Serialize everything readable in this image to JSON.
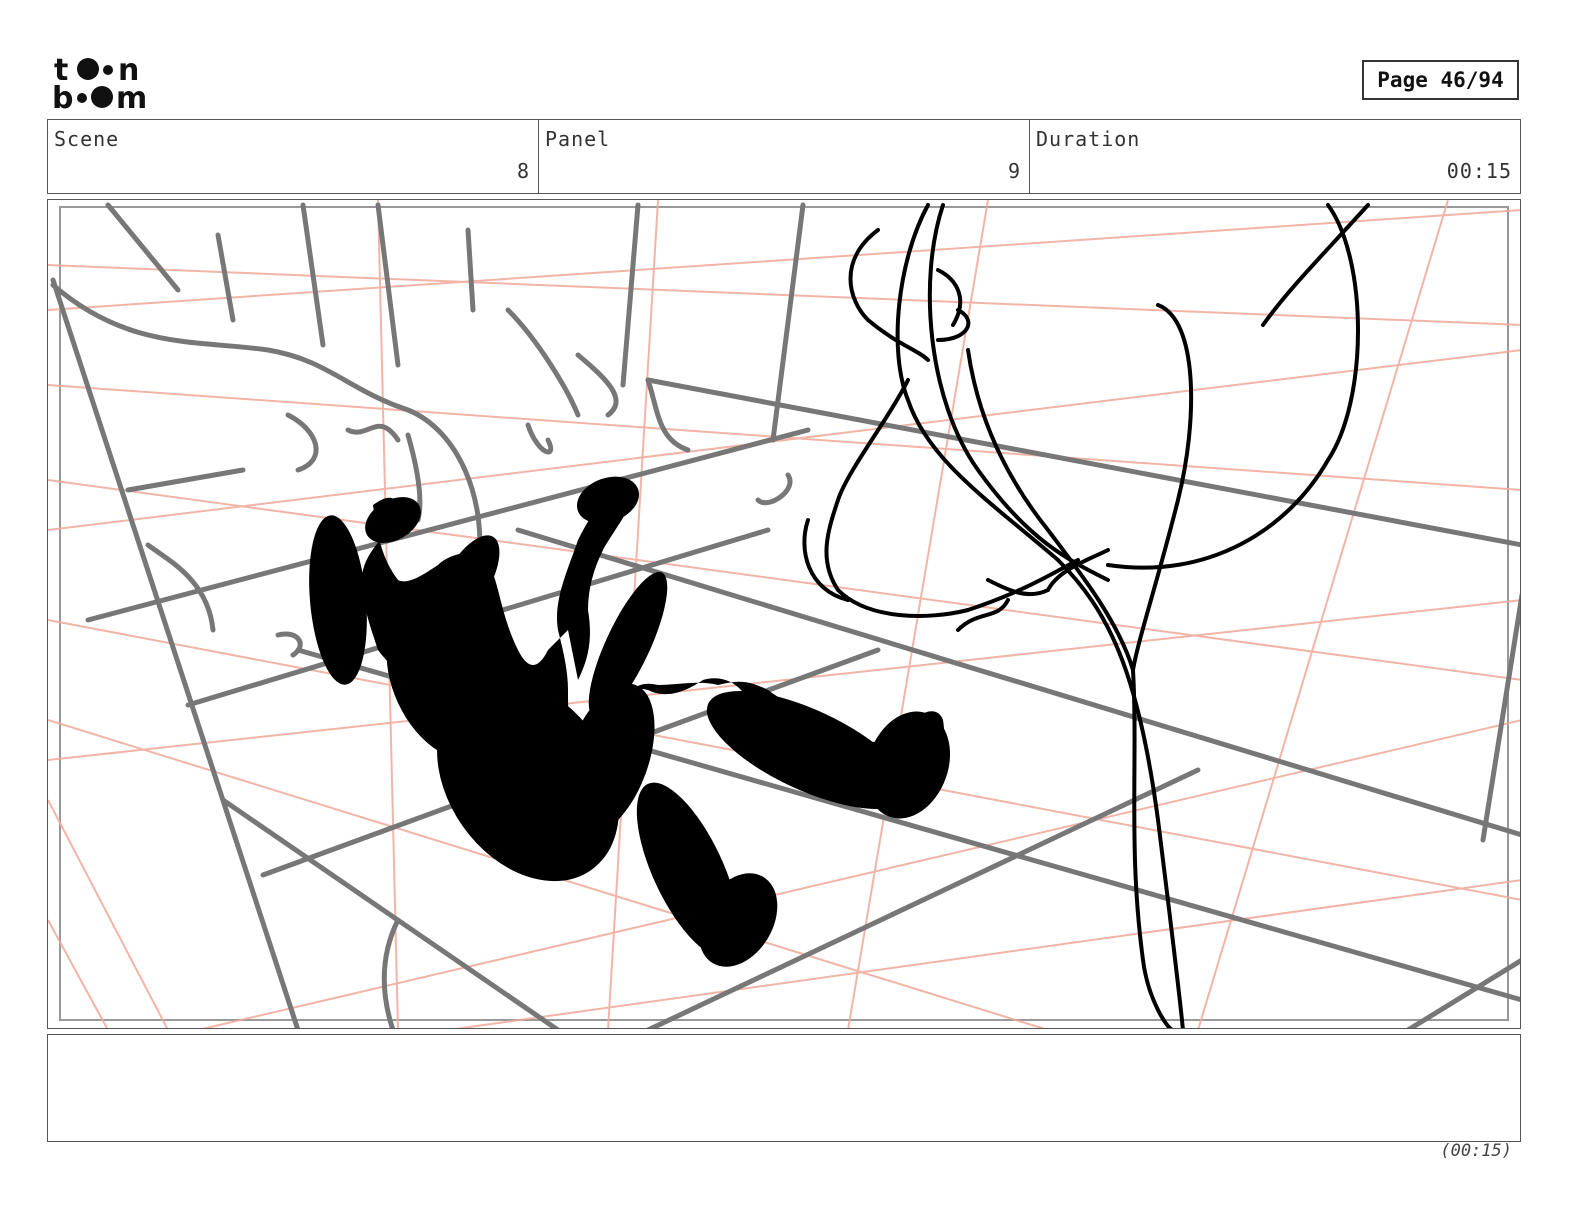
{
  "header": {
    "logo_name": "toon boom",
    "page_label": "Page 46/94"
  },
  "info": {
    "scene_label": "Scene",
    "scene_value": "8",
    "panel_label": "Panel",
    "panel_value": "9",
    "duration_label": "Duration",
    "duration_value": "00:15"
  },
  "notes": {
    "text": ""
  },
  "footer": {
    "duration_total": "(00:15)"
  }
}
